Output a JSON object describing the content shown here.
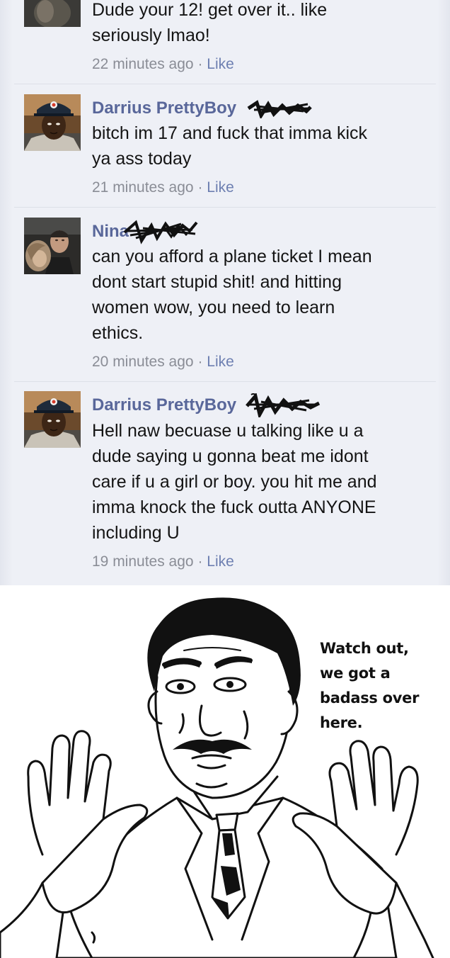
{
  "thread": {
    "comments": [
      {
        "author": "",
        "text": "Dude your 12! get over it.. like\nseriously lmao!",
        "time": "22 minutes ago",
        "separator": " · ",
        "action": "Like"
      },
      {
        "author": "Darrius PrettyBoy",
        "text": "bitch im 17 and fuck that imma kick\nya ass today",
        "time": "21 minutes ago",
        "separator": " · ",
        "action": "Like"
      },
      {
        "author": "Nina",
        "text": "can you afford a plane ticket I mean\ndont start stupid shit! and hitting\nwomen wow, you need to learn\nethics.",
        "time": "20 minutes ago",
        "separator": " · ",
        "action": "Like"
      },
      {
        "author": "Darrius PrettyBoy",
        "text": "Hell naw becuase u talking like u a\ndude saying u gonna beat me idont\ncare if u a girl or boy. you hit me and\nimma knock the fuck outta ANYONE\nincluding U",
        "time": "19 minutes ago",
        "separator": " · ",
        "action": "Like"
      }
    ],
    "icons": {
      "avatar_1": "profile-photo-icon",
      "avatar_2": "profile-photo-icon",
      "avatar_3": "profile-photo-icon",
      "avatar_4": "profile-photo-icon",
      "redaction": "scribble-redaction-icon"
    },
    "colors": {
      "background": "#eef0f6",
      "author_name": "#59679a",
      "like_link": "#6d7fb1",
      "timestamp": "#8a8d96",
      "body_text": "#141414"
    }
  },
  "meme": {
    "caption": "Watch out,\nwe got a\nbadass over\nhere.",
    "illustration": "rage-comic-watch-out-badass-man-icon"
  }
}
